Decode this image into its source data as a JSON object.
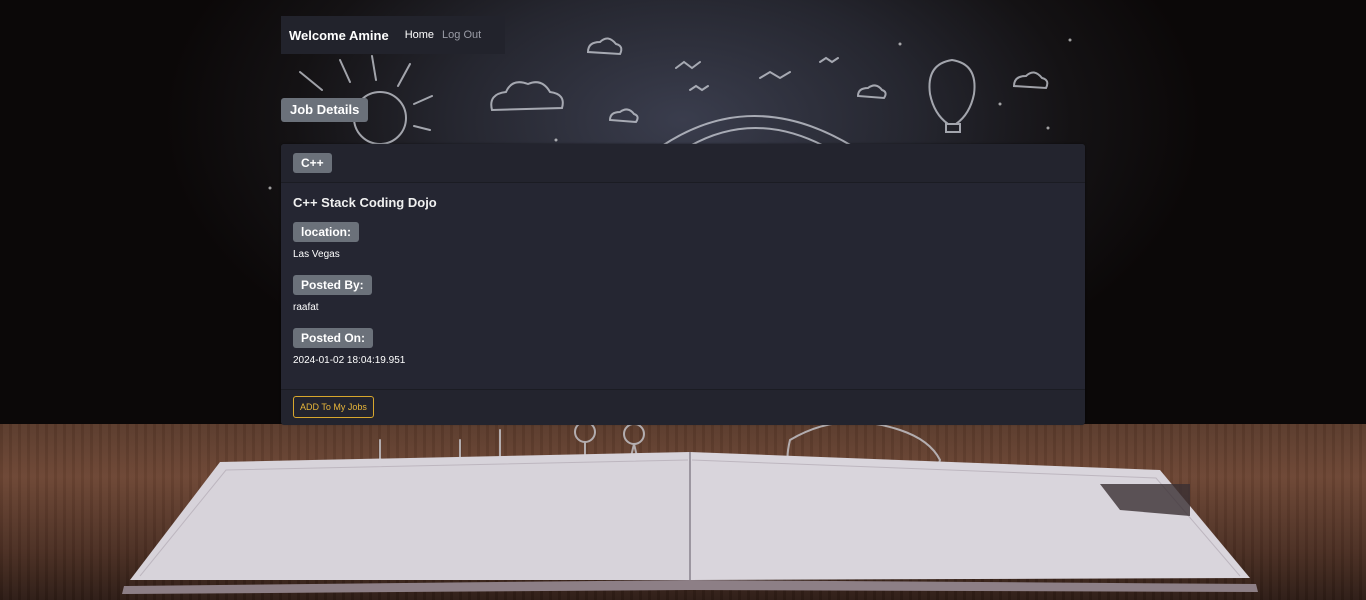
{
  "navbar": {
    "brand": "Welcome Amine",
    "links": [
      {
        "label": "Home"
      },
      {
        "label": "Log Out"
      }
    ]
  },
  "page": {
    "title": "Job Details"
  },
  "job": {
    "category": "C++",
    "title": "C++ Stack Coding Dojo",
    "fields": [
      {
        "label": "location:",
        "value": "Las Vegas"
      },
      {
        "label": "Posted By:",
        "value": "raafat"
      },
      {
        "label": "Posted On:",
        "value": "2024-01-02 18:04:19.951"
      }
    ],
    "action_label": "ADD To My Jobs"
  },
  "colors": {
    "accent": "#d8a72d",
    "badge": "#6b717a",
    "card": "#252632"
  }
}
